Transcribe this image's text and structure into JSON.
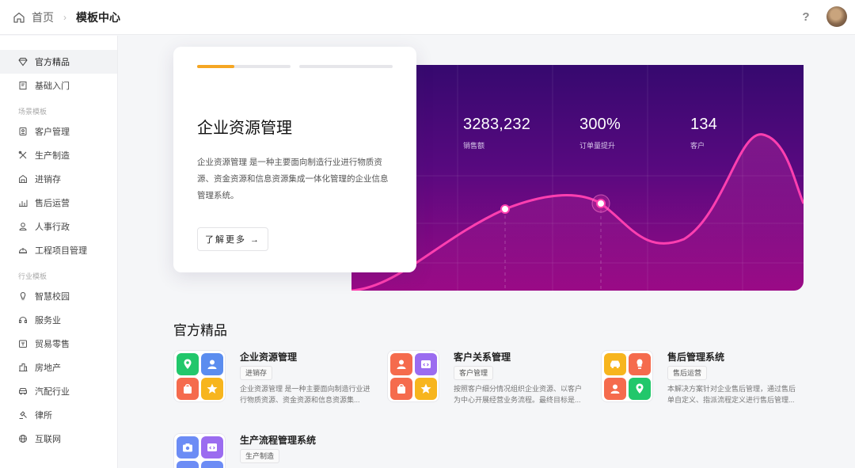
{
  "topbar": {
    "home_label": "首页",
    "current_label": "模板中心",
    "help_label": "?"
  },
  "sidebar": {
    "items_top": [
      {
        "label": "官方精品",
        "icon": "diamond-icon",
        "active": true
      },
      {
        "label": "基础入门",
        "icon": "book-icon",
        "active": false
      }
    ],
    "group_scene": "场景模板",
    "items_scene": [
      {
        "label": "客户管理",
        "icon": "id-card-icon"
      },
      {
        "label": "生产制造",
        "icon": "tools-icon"
      },
      {
        "label": "进销存",
        "icon": "warehouse-icon"
      },
      {
        "label": "售后运营",
        "icon": "chart-icon"
      },
      {
        "label": "人事行政",
        "icon": "person-icon"
      },
      {
        "label": "工程项目管理",
        "icon": "helmet-icon"
      }
    ],
    "group_industry": "行业模板",
    "items_industry": [
      {
        "label": "智慧校园",
        "icon": "bulb-icon"
      },
      {
        "label": "服务业",
        "icon": "headset-icon"
      },
      {
        "label": "贸易零售",
        "icon": "shop-icon"
      },
      {
        "label": "房地产",
        "icon": "building-icon"
      },
      {
        "label": "汽配行业",
        "icon": "car-icon"
      },
      {
        "label": "律所",
        "icon": "gavel-icon"
      },
      {
        "label": "互联网",
        "icon": "globe-icon"
      }
    ]
  },
  "hero": {
    "title": "企业资源管理",
    "description": "企业资源管理 是一种主要面向制造行业进行物质资源、资金资源和信息资源集成一体化管理的企业信息管理系统。",
    "button_label": "了解更多 →",
    "progress": 0.4,
    "stats": [
      {
        "value": "3283,232",
        "label": "销售额"
      },
      {
        "value": "300%",
        "label": "订单量提升"
      },
      {
        "value": "134",
        "label": "客户"
      }
    ],
    "colors": {
      "bg_top": "#36096f",
      "bg_bottom": "#9a0a86",
      "line": "#ff3fb0",
      "accent": "#f5a623"
    }
  },
  "section": {
    "title": "官方精品",
    "templates": [
      {
        "title": "企业资源管理",
        "tag": "进销存",
        "description": "企业资源管理 是一种主要面向制造行业进行物质资源、资金资源和信息资源集...",
        "icons": [
          "location-icon",
          "user-icon",
          "bag-icon",
          "star-icon"
        ]
      },
      {
        "title": "客户关系管理",
        "tag": "客户管理",
        "description": "按照客户细分情况组织企业资源、以客户为中心开展经营业务流程。最终目标是...",
        "icons": [
          "user-icon",
          "code-icon",
          "bag-icon",
          "star-icon"
        ]
      },
      {
        "title": "售后管理系统",
        "tag": "售后运营",
        "description": "本解决方案针对企业售后管理，通过售后单自定义、指派流程定义进行售后管理...",
        "icons": [
          "car-icon",
          "bulb-icon",
          "user-icon",
          "location-icon"
        ]
      },
      {
        "title": "生产流程管理系统",
        "tag": "生产制造",
        "description": "",
        "icons": [
          "camera-icon",
          "code-icon",
          "bag-icon",
          "box-icon"
        ]
      }
    ]
  }
}
